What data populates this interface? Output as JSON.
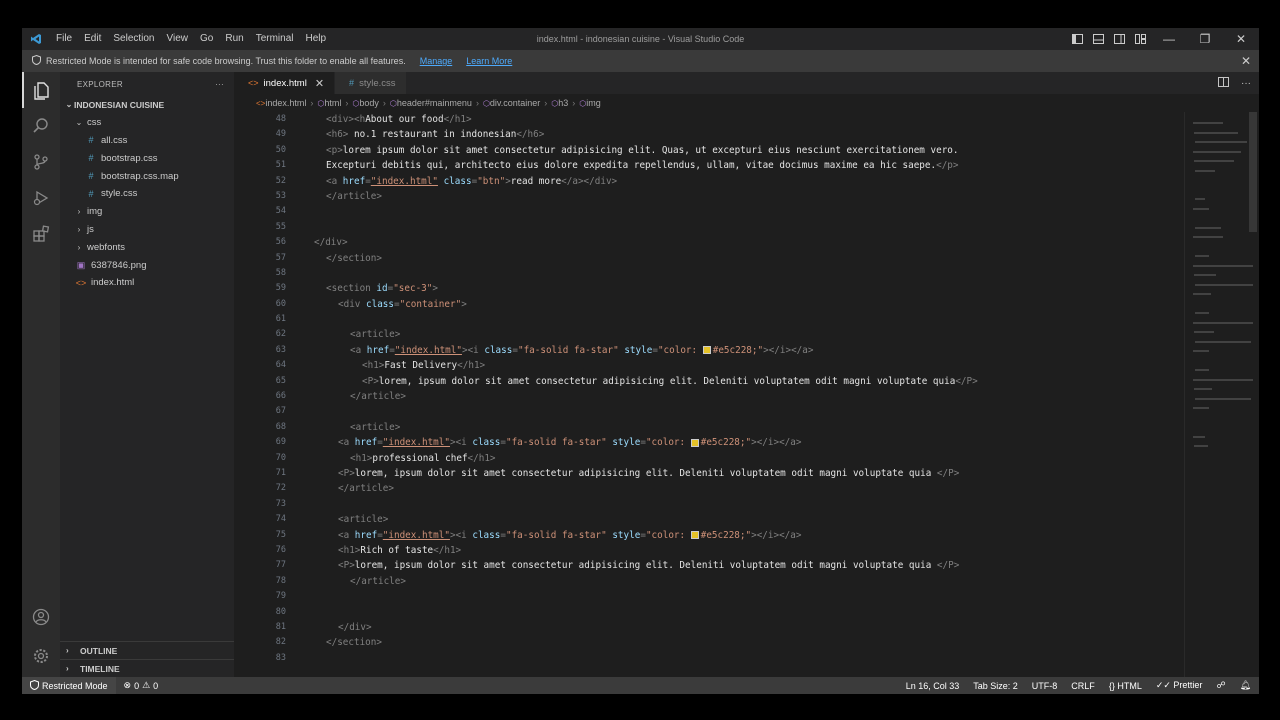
{
  "titlebar": {
    "menu": [
      "File",
      "Edit",
      "Selection",
      "View",
      "Go",
      "Run",
      "Terminal",
      "Help"
    ],
    "title": "index.html - indonesian cuisine - Visual Studio Code"
  },
  "banner": {
    "text": "Restricted Mode is intended for safe code browsing. Trust this folder to enable all features.",
    "manage": "Manage",
    "learn_more": "Learn More"
  },
  "sidebar": {
    "title": "EXPLORER",
    "more": "···",
    "root": "INDONESIAN CUISINE",
    "items": [
      {
        "label": "css",
        "type": "folder-open",
        "depth": 1
      },
      {
        "label": "all.css",
        "type": "css",
        "depth": 2
      },
      {
        "label": "bootstrap.css",
        "type": "css",
        "depth": 2
      },
      {
        "label": "bootstrap.css.map",
        "type": "css",
        "depth": 2
      },
      {
        "label": "style.css",
        "type": "css",
        "depth": 2
      },
      {
        "label": "img",
        "type": "folder",
        "depth": 1
      },
      {
        "label": "js",
        "type": "folder",
        "depth": 1
      },
      {
        "label": "webfonts",
        "type": "folder",
        "depth": 1
      },
      {
        "label": "6387846.png",
        "type": "image",
        "depth": 1
      },
      {
        "label": "index.html",
        "type": "html",
        "depth": 1
      }
    ],
    "outline": "OUTLINE",
    "timeline": "TIMELINE"
  },
  "tabs": [
    {
      "label": "index.html",
      "active": true,
      "close": "✕"
    },
    {
      "label": "style.css",
      "active": false
    }
  ],
  "breadcrumb": [
    "index.html",
    "html",
    "body",
    "header#mainmenu",
    "div.container",
    "h3",
    "img"
  ],
  "code": {
    "swatch_color": "#e5c228",
    "lines": [
      {
        "n": "48",
        "indent": 0,
        "parts": [
          [
            "tag",
            "<div><h"
          ],
          [
            "txt",
            "About our food"
          ],
          [
            "tag",
            "</h1>"
          ]
        ]
      },
      {
        "n": "49",
        "indent": 0,
        "parts": [
          [
            "tag",
            "<h6>"
          ],
          [
            "txt",
            " no.1 restaurant in indonesian"
          ],
          [
            "tag",
            "</h6>"
          ]
        ]
      },
      {
        "n": "50",
        "indent": 0,
        "parts": [
          [
            "tag",
            "<p>"
          ],
          [
            "txt",
            "lorem ipsum dolor sit amet consectetur adipisicing elit. Quas, ut excepturi eius nesciunt exercitationem vero."
          ]
        ]
      },
      {
        "n": "51",
        "indent": 0,
        "parts": [
          [
            "txt",
            "Excepturi debitis qui, architecto eius dolore expedita repellendus, ullam, vitae docimus maxime ea hic saepe."
          ],
          [
            "tag",
            "</p>"
          ]
        ]
      },
      {
        "n": "52",
        "indent": 0,
        "parts": [
          [
            "tag",
            "<a "
          ],
          [
            "attr",
            "href"
          ],
          [
            "tag",
            "="
          ],
          [
            "str",
            "\"index.html\""
          ],
          [
            "tag",
            " "
          ],
          [
            "attr",
            "class"
          ],
          [
            "tag",
            "="
          ],
          [
            "str",
            "\"btn\""
          ],
          [
            "tag",
            ">"
          ],
          [
            "txt",
            "read more"
          ],
          [
            "tag",
            "</a></div>"
          ]
        ]
      },
      {
        "n": "53",
        "indent": 0,
        "parts": [
          [
            "tag",
            "</article>"
          ]
        ]
      },
      {
        "n": "54",
        "indent": 0,
        "parts": []
      },
      {
        "n": "55",
        "indent": 0,
        "parts": []
      },
      {
        "n": "56",
        "indent": -1,
        "parts": [
          [
            "tag",
            "</div>"
          ]
        ]
      },
      {
        "n": "57",
        "indent": 0,
        "parts": [
          [
            "tag",
            "</section>"
          ]
        ]
      },
      {
        "n": "58",
        "indent": 0,
        "parts": []
      },
      {
        "n": "59",
        "indent": 0,
        "parts": [
          [
            "tag",
            "<section "
          ],
          [
            "attr",
            "id"
          ],
          [
            "tag",
            "="
          ],
          [
            "str",
            "\"sec-3\""
          ],
          [
            "tag",
            ">"
          ]
        ]
      },
      {
        "n": "60",
        "indent": 1,
        "parts": [
          [
            "tag",
            "<div "
          ],
          [
            "attr",
            "class"
          ],
          [
            "tag",
            "="
          ],
          [
            "str",
            "\"container\""
          ],
          [
            "tag",
            ">"
          ]
        ]
      },
      {
        "n": "61",
        "indent": 0,
        "parts": []
      },
      {
        "n": "62",
        "indent": 2,
        "parts": [
          [
            "tag",
            "<article>"
          ]
        ]
      },
      {
        "n": "63",
        "indent": 2,
        "parts": [
          [
            "tag",
            "<a "
          ],
          [
            "attr",
            "href"
          ],
          [
            "tag",
            "="
          ],
          [
            "str",
            "\"index.html\""
          ],
          [
            "tag",
            "><i "
          ],
          [
            "attr",
            "class"
          ],
          [
            "tag",
            "="
          ],
          [
            "str",
            "\"fa-solid fa-star\""
          ],
          [
            "tag",
            " "
          ],
          [
            "attr",
            "style"
          ],
          [
            "tag",
            "="
          ],
          [
            "str",
            "\"color: "
          ],
          [
            "swatch",
            ""
          ],
          [
            "str",
            "#e5c228;\""
          ],
          [
            "tag",
            "></i></a>"
          ]
        ]
      },
      {
        "n": "64",
        "indent": 3,
        "parts": [
          [
            "tag",
            "<h1>"
          ],
          [
            "txt",
            "Fast Delivery"
          ],
          [
            "tag",
            "</h1>"
          ]
        ]
      },
      {
        "n": "65",
        "indent": 3,
        "parts": [
          [
            "tag",
            "<P>"
          ],
          [
            "txt",
            "lorem, ipsum dolor sit amet consectetur adipisicing elit. Deleniti voluptatem odit magni voluptate quia"
          ],
          [
            "tag",
            "</P>"
          ]
        ]
      },
      {
        "n": "66",
        "indent": 2,
        "parts": [
          [
            "tag",
            "</article>"
          ]
        ]
      },
      {
        "n": "67",
        "indent": 0,
        "parts": []
      },
      {
        "n": "68",
        "indent": 2,
        "parts": [
          [
            "tag",
            "<article>"
          ]
        ]
      },
      {
        "n": "69",
        "indent": 1,
        "parts": [
          [
            "tag",
            "<a "
          ],
          [
            "attr",
            "href"
          ],
          [
            "tag",
            "="
          ],
          [
            "str",
            "\"index.html\""
          ],
          [
            "tag",
            "><i "
          ],
          [
            "attr",
            "class"
          ],
          [
            "tag",
            "="
          ],
          [
            "str",
            "\"fa-solid fa-star\""
          ],
          [
            "tag",
            " "
          ],
          [
            "attr",
            "style"
          ],
          [
            "tag",
            "="
          ],
          [
            "str",
            "\"color: "
          ],
          [
            "swatch",
            ""
          ],
          [
            "str",
            "#e5c228;\""
          ],
          [
            "tag",
            "></i></a>"
          ]
        ]
      },
      {
        "n": "70",
        "indent": 2,
        "parts": [
          [
            "tag",
            "<h1>"
          ],
          [
            "txt",
            "professional chef"
          ],
          [
            "tag",
            "</h1>"
          ]
        ]
      },
      {
        "n": "71",
        "indent": 1,
        "parts": [
          [
            "tag",
            "<P>"
          ],
          [
            "txt",
            "lorem, ipsum dolor sit amet consectetur adipisicing elit. Deleniti voluptatem odit magni voluptate quia "
          ],
          [
            "tag",
            "</P>"
          ]
        ]
      },
      {
        "n": "72",
        "indent": 1,
        "parts": [
          [
            "tag",
            "</article>"
          ]
        ]
      },
      {
        "n": "73",
        "indent": 0,
        "parts": []
      },
      {
        "n": "74",
        "indent": 1,
        "parts": [
          [
            "tag",
            "<article>"
          ]
        ]
      },
      {
        "n": "75",
        "indent": 1,
        "parts": [
          [
            "tag",
            "<a "
          ],
          [
            "attr",
            "href"
          ],
          [
            "tag",
            "="
          ],
          [
            "str",
            "\"index.html\""
          ],
          [
            "tag",
            "><i "
          ],
          [
            "attr",
            "class"
          ],
          [
            "tag",
            "="
          ],
          [
            "str",
            "\"fa-solid fa-star\""
          ],
          [
            "tag",
            " "
          ],
          [
            "attr",
            "style"
          ],
          [
            "tag",
            "="
          ],
          [
            "str",
            "\"color: "
          ],
          [
            "swatch",
            ""
          ],
          [
            "str",
            "#e5c228;\""
          ],
          [
            "tag",
            "></i></a>"
          ]
        ]
      },
      {
        "n": "76",
        "indent": 1,
        "parts": [
          [
            "tag",
            "<h1>"
          ],
          [
            "txt",
            "Rich of taste"
          ],
          [
            "tag",
            "</h1>"
          ]
        ]
      },
      {
        "n": "77",
        "indent": 1,
        "parts": [
          [
            "tag",
            "<P>"
          ],
          [
            "txt",
            "lorem, ipsum dolor sit amet consectetur adipisicing elit. Deleniti voluptatem odit magni voluptate quia "
          ],
          [
            "tag",
            "</P>"
          ]
        ]
      },
      {
        "n": "78",
        "indent": 2,
        "parts": [
          [
            "tag",
            "</article>"
          ]
        ]
      },
      {
        "n": "79",
        "indent": 0,
        "parts": []
      },
      {
        "n": "80",
        "indent": 0,
        "parts": []
      },
      {
        "n": "81",
        "indent": 1,
        "parts": [
          [
            "tag",
            "</div>"
          ]
        ]
      },
      {
        "n": "82",
        "indent": 0,
        "parts": [
          [
            "tag",
            "</section>"
          ]
        ]
      },
      {
        "n": "83",
        "indent": 0,
        "parts": []
      }
    ]
  },
  "statusbar": {
    "restricted": "Restricted Mode",
    "errors": "0",
    "warnings": "0",
    "position": "Ln 16, Col 33",
    "tab_size": "Tab Size: 2",
    "encoding": "UTF-8",
    "eol": "CRLF",
    "language": "HTML",
    "formatter": "Prettier"
  }
}
